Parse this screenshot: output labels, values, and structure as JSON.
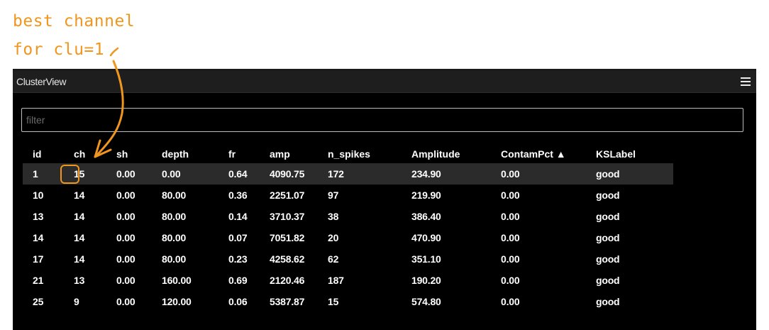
{
  "annotation": {
    "line1": "best channel",
    "line2": "for clu=1"
  },
  "colors": {
    "annotation": "#f0961e",
    "background": "#000000",
    "titlebar": "#1e1e1e",
    "selected_row": "#2b2b2b",
    "text": "#ffffff"
  },
  "dock": {
    "title": "ClusterView",
    "menu_icon": "hamburger-menu-icon"
  },
  "filter": {
    "placeholder": "filter",
    "value": ""
  },
  "table": {
    "columns": [
      "id",
      "ch",
      "sh",
      "depth",
      "fr",
      "amp",
      "n_spikes",
      "Amplitude",
      "ContamPct ▲",
      "KSLabel"
    ],
    "sort": {
      "column": "ContamPct",
      "direction": "ascending"
    },
    "selected_row_index": 0,
    "rows": [
      [
        "1",
        "15",
        "0.00",
        "0.00",
        "0.64",
        "4090.75",
        "172",
        "234.90",
        "0.00",
        "good"
      ],
      [
        "10",
        "14",
        "0.00",
        "80.00",
        "0.36",
        "2251.07",
        "97",
        "219.90",
        "0.00",
        "good"
      ],
      [
        "13",
        "14",
        "0.00",
        "80.00",
        "0.14",
        "3710.37",
        "38",
        "386.40",
        "0.00",
        "good"
      ],
      [
        "14",
        "14",
        "0.00",
        "80.00",
        "0.07",
        "7051.82",
        "20",
        "470.90",
        "0.00",
        "good"
      ],
      [
        "17",
        "14",
        "0.00",
        "80.00",
        "0.23",
        "4258.62",
        "62",
        "351.10",
        "0.00",
        "good"
      ],
      [
        "21",
        "13",
        "0.00",
        "160.00",
        "0.69",
        "2120.46",
        "187",
        "190.20",
        "0.00",
        "good"
      ],
      [
        "25",
        "9",
        "0.00",
        "120.00",
        "0.06",
        "5387.87",
        "15",
        "574.80",
        "0.00",
        "good"
      ]
    ]
  }
}
